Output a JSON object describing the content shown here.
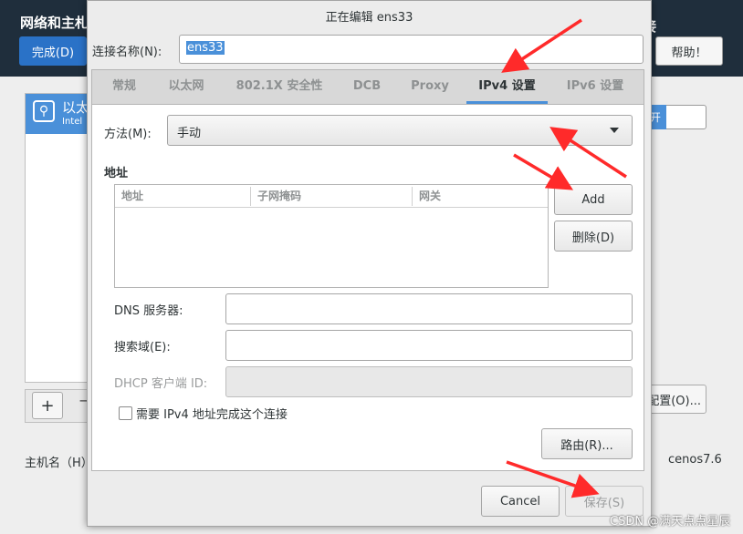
{
  "background_window": {
    "title_fragment": "网络和主札",
    "done_button": "完成(D)",
    "help_fragment": "接",
    "help_button": "帮助！",
    "list_item_title": "以太",
    "list_item_subtitle": "Intel",
    "toggle_fragment": "开",
    "add_button": "+",
    "remove_button": "−",
    "configure_button": "配置(O)...",
    "hostname_label": "主机名（H）",
    "hostname_value": "cenos7.6"
  },
  "dialog": {
    "title": "正在编辑 ens33",
    "connection_name_label": "连接名称(N):",
    "connection_name_value": "ens33",
    "tabs": [
      {
        "label": "常规",
        "active": false
      },
      {
        "label": "以太网",
        "active": false
      },
      {
        "label": "802.1X 安全性",
        "active": false
      },
      {
        "label": "DCB",
        "active": false
      },
      {
        "label": "Proxy",
        "active": false
      },
      {
        "label": "IPv4 设置",
        "active": true
      },
      {
        "label": "IPv6 设置",
        "active": false
      }
    ],
    "ipv4": {
      "method_label": "方法(M):",
      "method_value": "手动",
      "address_section_label": "地址",
      "address_columns": [
        "地址",
        "子网掩码",
        "网关"
      ],
      "add_button": "Add",
      "delete_button": "删除(D)",
      "dns_label": "DNS 服务器:",
      "dns_value": "",
      "search_domain_label": "搜索域(E):",
      "search_domain_value": "",
      "dhcp_client_id_label": "DHCP 客户端 ID:",
      "dhcp_client_id_value": "",
      "require_ipv4_label": "需要 IPv4 地址完成这个连接",
      "require_ipv4_checked": false,
      "routes_button": "路由(R)..."
    },
    "cancel_button": "Cancel",
    "save_button": "保存(S)"
  },
  "watermark": "CSDN @满天点点星辰",
  "colors": {
    "accent": "#4a90d9",
    "header_bg": "#1f2e3c",
    "annotation_arrow": "#ff2a2a"
  }
}
